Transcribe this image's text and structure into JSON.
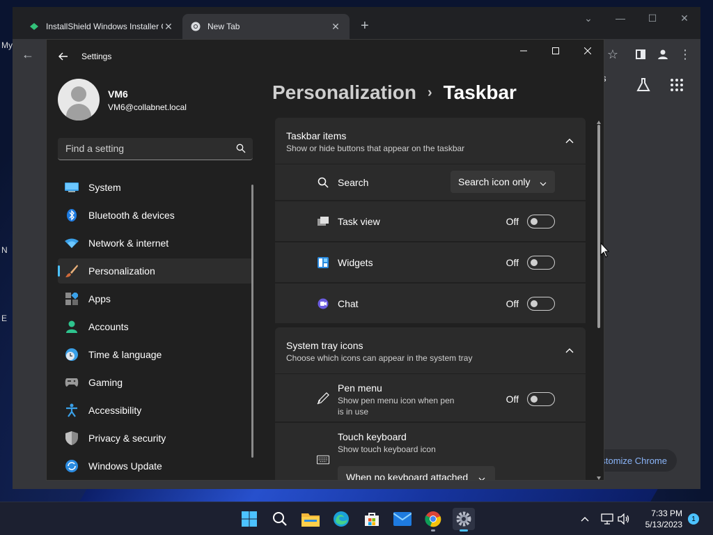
{
  "desktop": {
    "icon_labels": [
      "My",
      "N",
      "E"
    ]
  },
  "chrome": {
    "tabs": [
      {
        "title": "InstallShield Windows Installer Ge",
        "icon": "installshield-icon"
      },
      {
        "title": "New Tab",
        "icon": "chrome-icon"
      }
    ],
    "new_tab_symbol": "+",
    "partial_text": "ges",
    "customize_label": "Customize Chrome"
  },
  "settings": {
    "window_title": "Settings",
    "user": {
      "name": "VM6",
      "email": "VM6@collabnet.local"
    },
    "search_placeholder": "Find a setting",
    "nav": [
      {
        "label": "System",
        "icon": "system-icon"
      },
      {
        "label": "Bluetooth & devices",
        "icon": "bluetooth-icon"
      },
      {
        "label": "Network & internet",
        "icon": "wifi-icon"
      },
      {
        "label": "Personalization",
        "icon": "paintbrush-icon",
        "active": true
      },
      {
        "label": "Apps",
        "icon": "apps-icon"
      },
      {
        "label": "Accounts",
        "icon": "accounts-icon"
      },
      {
        "label": "Time & language",
        "icon": "time-language-icon"
      },
      {
        "label": "Gaming",
        "icon": "gamepad-icon"
      },
      {
        "label": "Accessibility",
        "icon": "accessibility-icon"
      },
      {
        "label": "Privacy & security",
        "icon": "shield-icon"
      },
      {
        "label": "Windows Update",
        "icon": "windows-update-icon"
      }
    ],
    "breadcrumb": {
      "parent": "Personalization",
      "separator": "›",
      "current": "Taskbar"
    },
    "sections": {
      "taskbar_items": {
        "title": "Taskbar items",
        "subtitle": "Show or hide buttons that appear on the taskbar",
        "rows": [
          {
            "label": "Search",
            "control": "dropdown",
            "value": "Search icon only",
            "icon": "search-icon"
          },
          {
            "label": "Task view",
            "control": "toggle",
            "state": "Off",
            "icon": "task-view-icon"
          },
          {
            "label": "Widgets",
            "control": "toggle",
            "state": "Off",
            "icon": "widgets-icon"
          },
          {
            "label": "Chat",
            "control": "toggle",
            "state": "Off",
            "icon": "chat-icon"
          }
        ]
      },
      "system_tray": {
        "title": "System tray icons",
        "subtitle": "Choose which icons can appear in the system tray",
        "rows": [
          {
            "label": "Pen menu",
            "description": "Show pen menu icon when pen is in use",
            "control": "toggle",
            "state": "Off",
            "icon": "pen-icon"
          },
          {
            "label": "Touch keyboard",
            "description": "Show touch keyboard icon",
            "control": "dropdown",
            "value": "When no keyboard attached",
            "icon": "keyboard-icon"
          }
        ]
      }
    }
  },
  "taskbar": {
    "apps": [
      "windows-start-icon",
      "search-icon",
      "file-explorer-icon",
      "edge-icon",
      "store-icon",
      "mail-icon",
      "chrome-icon",
      "settings-icon"
    ],
    "clock_time": "7:33 PM",
    "clock_date": "5/13/2023",
    "notification_count": "1"
  },
  "colors": {
    "accent": "#4cc2ff",
    "settings_bg": "#202020",
    "card_bg": "#2b2b2b",
    "chrome_bg": "#35363a"
  }
}
